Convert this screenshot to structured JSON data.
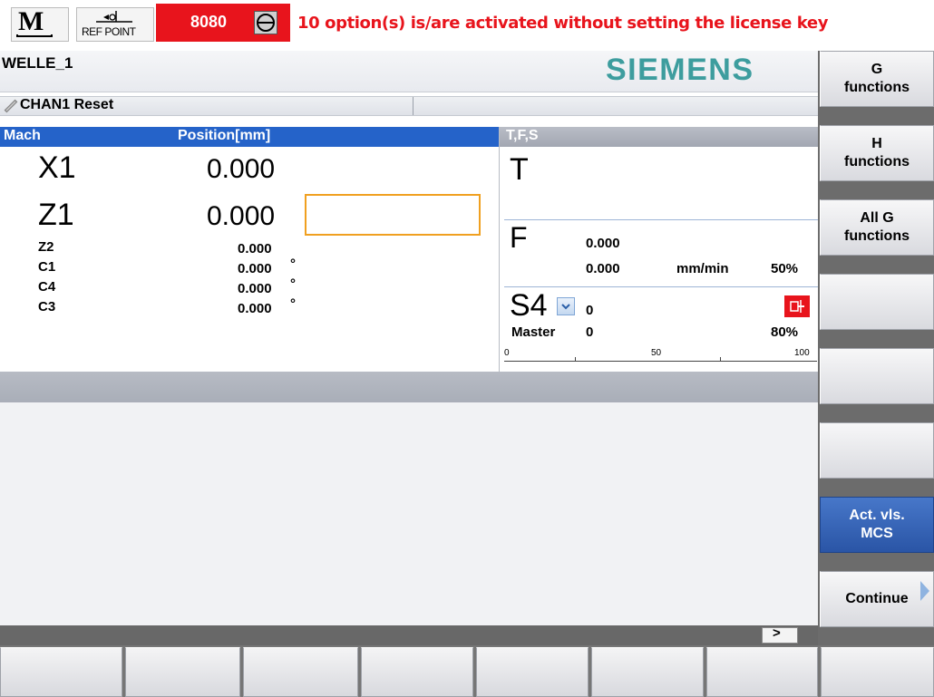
{
  "top_bar": {
    "mode_letter": "M",
    "refpoint_label": "REF POINT",
    "alarm_number": "8080",
    "alarm_message": "10 option(s) is/are activated without setting the license key",
    "alarm_color": "#e8141c"
  },
  "header": {
    "program_name": "WELLE_1",
    "brand": "SIEMENS",
    "brand_color": "#3d9d9e",
    "channel_status": "CHAN1 Reset"
  },
  "position": {
    "col_mach": "Mach",
    "col_position": "Position[mm]",
    "axes": [
      {
        "name": "X1",
        "value": "0.000",
        "unit": ""
      },
      {
        "name": "Z1",
        "value": "0.000",
        "unit": ""
      },
      {
        "name": "Z2",
        "value": "0.000",
        "unit": ""
      },
      {
        "name": "C1",
        "value": "0.000",
        "unit": "°"
      },
      {
        "name": "C4",
        "value": "0.000",
        "unit": "°"
      },
      {
        "name": "C3",
        "value": "0.000",
        "unit": "°"
      }
    ]
  },
  "tfs": {
    "title": "T,F,S",
    "t_label": "T",
    "f_label": "F",
    "f_value1": "0.000",
    "f_value2": "0.000",
    "f_unit": "mm/min",
    "f_override": "50%",
    "s_label": "S4",
    "s_value": "0",
    "master_label": "Master",
    "master_value": "0",
    "s_override": "80%",
    "scale": [
      "0",
      "50",
      "100"
    ]
  },
  "lower": {
    "scroll_right": ">"
  },
  "softkeys": {
    "vertical": [
      {
        "label": "G\nfunctions",
        "active": false
      },
      {
        "label": "H\nfunctions",
        "active": false
      },
      {
        "label": "All G\nfunctions",
        "active": false
      },
      {
        "label": "",
        "active": false
      },
      {
        "label": "",
        "active": false
      },
      {
        "label": "",
        "active": false
      },
      {
        "label": "Act. vls.\nMCS",
        "active": true
      },
      {
        "label": "Continue",
        "active": false
      }
    ]
  }
}
